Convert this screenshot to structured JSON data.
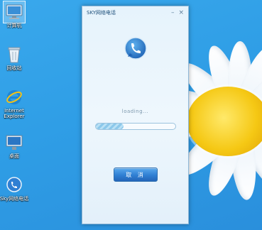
{
  "desktop": {
    "icons": [
      {
        "label": "计算机",
        "icon": "computer-icon",
        "selected": true
      },
      {
        "label": "回收站",
        "icon": "recycle-bin-icon",
        "selected": false
      },
      {
        "label": "Internet Explorer",
        "icon": "ie-icon",
        "selected": false
      },
      {
        "label": "桌面",
        "icon": "desktop-icon",
        "selected": false
      },
      {
        "label": "Sky网络电话",
        "icon": "sky-phone-icon",
        "selected": false
      }
    ]
  },
  "dialog": {
    "title": "SKY网络电话",
    "minimize_glyph": "–",
    "close_glyph": "×",
    "loading_text": "loading...",
    "progress": 0.35,
    "cancel_label": "取 消",
    "logo_icon": "phone-bubble-icon"
  },
  "colors": {
    "wallpaper": "#2f9ee6",
    "button": "#2f7fd3",
    "flower_center": "#f5c814"
  }
}
